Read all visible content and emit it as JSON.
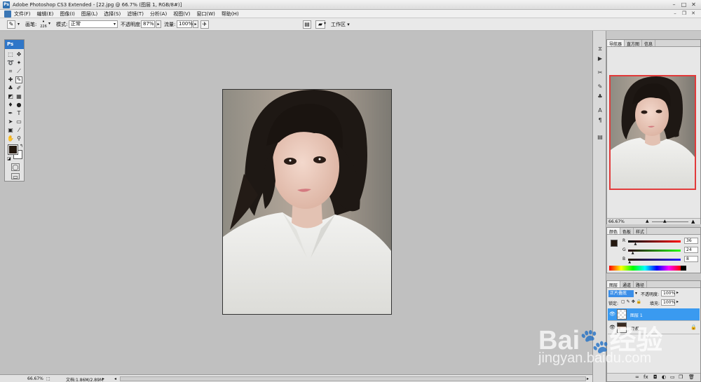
{
  "window": {
    "title": "Adobe Photoshop CS3 Extended - [22.jpg @ 66.7% (图层 1, RGB/8#)]",
    "app_badge": "Ps"
  },
  "menu": {
    "items": [
      "文件(F)",
      "编辑(E)",
      "图像(I)",
      "图层(L)",
      "选择(S)",
      "滤镜(T)",
      "分析(A)",
      "视图(V)",
      "窗口(W)",
      "帮助(H)"
    ]
  },
  "options": {
    "brush_label": "画笔:",
    "brush_size": "226",
    "mode_label": "模式:",
    "mode_value": "正常",
    "opacity_label": "不透明度:",
    "opacity_value": "87%",
    "flow_label": "流量:",
    "flow_value": "100%",
    "workspace_label": "工作区 ▾"
  },
  "toolbox": {
    "title": "Ps",
    "fg_color": "#24180f",
    "bg_color": "#ffffff"
  },
  "statusbar": {
    "zoom": "66.67%",
    "doc_info": "文档:1.86M/2.89M"
  },
  "navigator": {
    "tabs": [
      "导航器",
      "直方图",
      "信息"
    ],
    "zoom": "66.67%"
  },
  "color": {
    "tabs": [
      "颜色",
      "色板",
      "样式"
    ],
    "r_label": "R",
    "r_value": "36",
    "r_level": 0.14,
    "g_label": "G",
    "g_value": "24",
    "g_level": 0.09,
    "b_label": "B",
    "b_value": "8",
    "b_level": 0.03
  },
  "layers": {
    "tabs": [
      "图层",
      "通道",
      "路径"
    ],
    "blend_mode": "正片叠底",
    "opacity_label": "不透明度:",
    "opacity_value": "100%",
    "lock_label": "锁定:",
    "fill_label": "填充:",
    "fill_value": "100%",
    "rows": [
      {
        "name": "图层 1"
      },
      {
        "name": "背景"
      }
    ]
  },
  "watermark": {
    "brand": "Bai",
    "brand_cn": "经验",
    "url": "jingyan.baidu.com"
  }
}
